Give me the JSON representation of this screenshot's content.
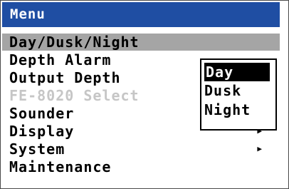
{
  "menu": {
    "title": "Menu",
    "items": [
      {
        "label": "Day/Dusk/Night"
      },
      {
        "label": "Depth Alarm"
      },
      {
        "label": "Output Depth"
      },
      {
        "label": "FE-8020 Select"
      },
      {
        "label": "Sounder"
      },
      {
        "label": "Display",
        "arrow": "▶"
      },
      {
        "label": "System",
        "arrow": "▶"
      },
      {
        "label": "Maintenance"
      }
    ]
  },
  "submenu": {
    "items": [
      {
        "label": "Day"
      },
      {
        "label": "Dusk"
      },
      {
        "label": "Night"
      }
    ]
  },
  "colors": {
    "titlebar": "#1f4ea3",
    "highlight": "#a5a5a5",
    "disabled": "#c6c6c6"
  }
}
